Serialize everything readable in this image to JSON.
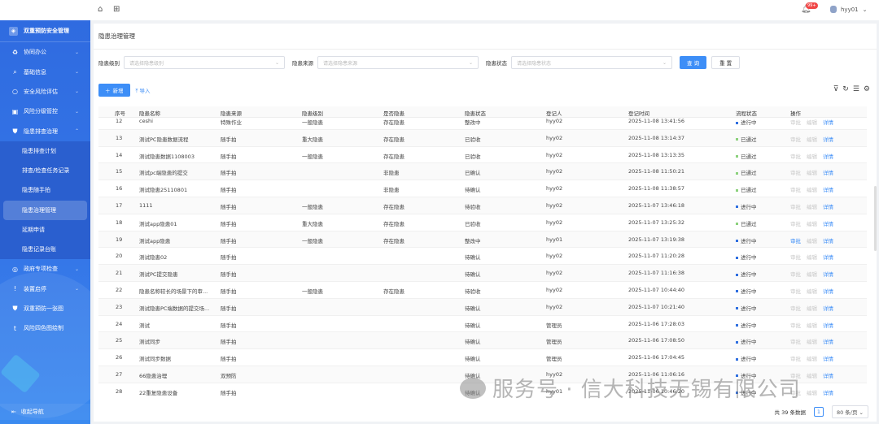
{
  "topbar": {
    "notification_badge": "99+",
    "username": "hyy01"
  },
  "sidebar": {
    "brand": "双重预防安全管理",
    "items_top": [
      {
        "label": "协同办公",
        "icon": "recycle-icon"
      },
      {
        "label": "基础信息",
        "icon": "search-icon"
      },
      {
        "label": "安全风险评估",
        "icon": "circle-icon"
      },
      {
        "label": "风险分级管控",
        "icon": "folder-icon"
      },
      {
        "label": "隐患排查治理",
        "icon": "shield-icon"
      }
    ],
    "submenu": [
      "隐患排查计划",
      "排查/检查任务记录",
      "隐患随手拍",
      "隐患治理管理",
      "延期申请",
      "隐患记录台账"
    ],
    "active_sub": "隐患治理管理",
    "items_bottom": [
      {
        "label": "政府专项检查",
        "icon": "target-icon"
      },
      {
        "label": "装置启停",
        "icon": "power-icon"
      },
      {
        "label": "双重预防一张图",
        "icon": "shield-icon"
      },
      {
        "label": "风险四色图绘制",
        "icon": "paint-icon"
      }
    ],
    "collapse": "收起导航"
  },
  "page": {
    "title": "隐患治理管理"
  },
  "filters": [
    {
      "label": "隐患级别",
      "placeholder": "请选择隐患级别"
    },
    {
      "label": "隐患来源",
      "placeholder": "请选择隐患来源"
    },
    {
      "label": "隐患状态",
      "placeholder": "请选择隐患状态"
    }
  ],
  "buttons": {
    "query": "查 询",
    "reset": "重 置",
    "add": "新增",
    "import": "导入"
  },
  "table": {
    "columns": [
      "序号",
      "隐患名称",
      "隐患来源",
      "隐患级别",
      "是否隐患",
      "隐患状态",
      "登记人",
      "登记时间",
      "流程状态",
      "操作"
    ],
    "ops": [
      "审批",
      "编辑",
      "详情"
    ],
    "rows": [
      {
        "no": "12",
        "name": "ceshi",
        "source": "特殊作业",
        "level": "一般隐患",
        "is": "存在隐患",
        "status": "整改中",
        "user": "hyy02",
        "time": "2025-11-08 13:41:56",
        "flow": "进行中",
        "approve": false
      },
      {
        "no": "13",
        "name": "测试PC隐患数据流程",
        "source": "随手拍",
        "level": "重大隐患",
        "is": "存在隐患",
        "status": "已验收",
        "user": "hyy02",
        "time": "2025-11-08 13:14:37",
        "flow": "已通过",
        "approve": false
      },
      {
        "no": "14",
        "name": "测试隐患数据1108003",
        "source": "随手拍",
        "level": "一般隐患",
        "is": "存在隐患",
        "status": "已验收",
        "user": "hyy02",
        "time": "2025-11-08 13:13:35",
        "flow": "已通过",
        "approve": false
      },
      {
        "no": "15",
        "name": "测试pc端隐患的提交",
        "source": "随手拍",
        "level": "",
        "is": "非隐患",
        "status": "已确认",
        "user": "hyy02",
        "time": "2025-11-08 11:50:21",
        "flow": "已通过",
        "approve": false
      },
      {
        "no": "16",
        "name": "测试隐患25110801",
        "source": "随手拍",
        "level": "",
        "is": "非隐患",
        "status": "待确认",
        "user": "hyy02",
        "time": "2025-11-08 11:38:57",
        "flow": "已通过",
        "approve": false
      },
      {
        "no": "17",
        "name": "1111",
        "source": "随手拍",
        "level": "一般隐患",
        "is": "存在隐患",
        "status": "待验收",
        "user": "hyy02",
        "time": "2025-11-07 13:46:18",
        "flow": "进行中",
        "approve": false
      },
      {
        "no": "18",
        "name": "测试app隐患01",
        "source": "随手拍",
        "level": "重大隐患",
        "is": "存在隐患",
        "status": "已验收",
        "user": "hyy02",
        "time": "2025-11-07 13:25:32",
        "flow": "已通过",
        "approve": false
      },
      {
        "no": "19",
        "name": "测试app隐患",
        "source": "随手拍",
        "level": "一般隐患",
        "is": "存在隐患",
        "status": "整改中",
        "user": "hyy01",
        "time": "2025-11-07 13:19:38",
        "flow": "进行中",
        "approve": true
      },
      {
        "no": "20",
        "name": "测试隐患02",
        "source": "随手拍",
        "level": "",
        "is": "",
        "status": "待确认",
        "user": "hyy02",
        "time": "2025-11-07 11:20:28",
        "flow": "进行中",
        "approve": false
      },
      {
        "no": "21",
        "name": "测试PC提交隐患",
        "source": "随手拍",
        "level": "",
        "is": "",
        "status": "待确认",
        "user": "hyy02",
        "time": "2025-11-07 11:16:38",
        "flow": "进行中",
        "approve": false
      },
      {
        "no": "22",
        "name": "隐患名称较长的场景下的审...",
        "source": "随手拍",
        "level": "一般隐患",
        "is": "存在隐患",
        "status": "待验收",
        "user": "hyy02",
        "time": "2025-11-07 10:44:40",
        "flow": "进行中",
        "approve": false
      },
      {
        "no": "23",
        "name": "测试隐患PC端数据的提交场...",
        "source": "随手拍",
        "level": "",
        "is": "",
        "status": "待确认",
        "user": "hyy02",
        "time": "2025-11-07 10:21:40",
        "flow": "进行中",
        "approve": false
      },
      {
        "no": "24",
        "name": "测试",
        "source": "随手拍",
        "level": "",
        "is": "",
        "status": "待确认",
        "user": "管理员",
        "time": "2025-11-06 17:28:03",
        "flow": "进行中",
        "approve": false
      },
      {
        "no": "25",
        "name": "测试同步",
        "source": "随手拍",
        "level": "",
        "is": "",
        "status": "待确认",
        "user": "管理员",
        "time": "2025-11-06 17:08:50",
        "flow": "进行中",
        "approve": false
      },
      {
        "no": "26",
        "name": "测试同步数据",
        "source": "随手拍",
        "level": "",
        "is": "",
        "status": "待确认",
        "user": "管理员",
        "time": "2025-11-06 17:04:45",
        "flow": "进行中",
        "approve": false
      },
      {
        "no": "27",
        "name": "66隐患治理",
        "source": "双预防",
        "level": "",
        "is": "",
        "status": "待确认",
        "user": "hyy02",
        "time": "2025-11-06 11:06:16",
        "flow": "进行中",
        "approve": false
      },
      {
        "no": "28",
        "name": "22重复隐患设备",
        "source": "随手拍",
        "level": "",
        "is": "",
        "status": "待确认",
        "user": "hyy01",
        "time": "2025-11-06 10:46:20",
        "flow": "进行中",
        "approve": false
      }
    ]
  },
  "flow_colors": {
    "进行中": "#2f6fe0",
    "已通过": "#8bd17c"
  },
  "pagination": {
    "total": "共 39 条数据",
    "current": "1",
    "page_size": "80 条/页"
  },
  "watermark": "服务号 · 信大科技无锡有限公司"
}
